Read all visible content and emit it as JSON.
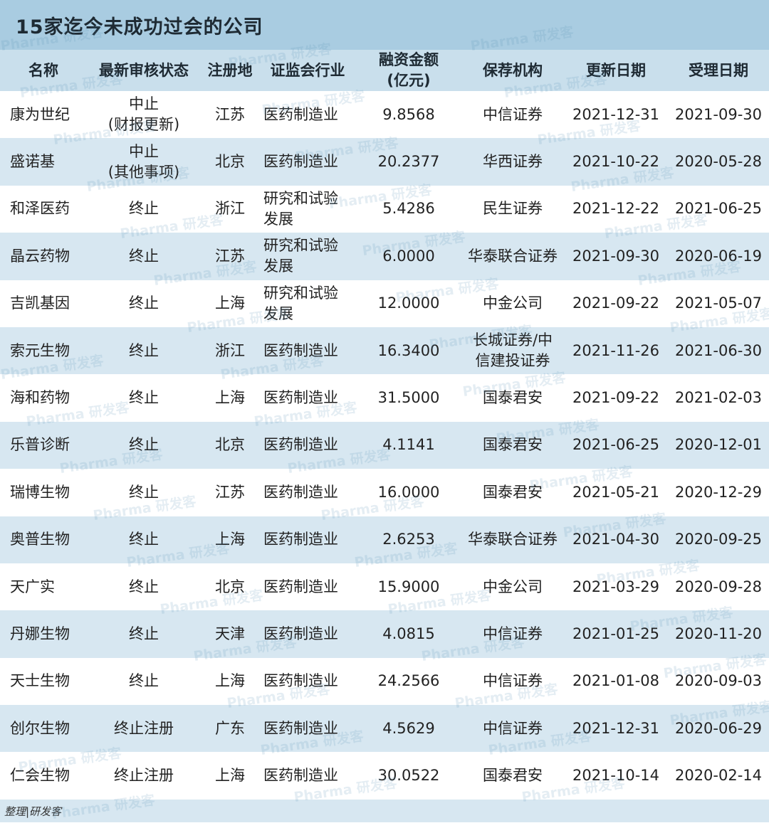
{
  "title": "15家迄今未成功过会的公司",
  "columns": [
    "名称",
    "最新审核状态",
    "注册地",
    "证监会行业",
    "融资金额\n(亿元)",
    "保荐机构",
    "更新日期",
    "受理日期"
  ],
  "rows": [
    [
      "康为世纪",
      "中止\n(财报更新)",
      "江苏",
      "医药制造业",
      "9.8568",
      "中信证券",
      "2021-12-31",
      "2021-09-30"
    ],
    [
      "盛诺基",
      "中止\n(其他事项)",
      "北京",
      "医药制造业",
      "20.2377",
      "华西证券",
      "2021-10-22",
      "2020-05-28"
    ],
    [
      "和泽医药",
      "终止",
      "浙江",
      "研究和试验\n发展",
      "5.4286",
      "民生证券",
      "2021-12-22",
      "2021-06-25"
    ],
    [
      "晶云药物",
      "终止",
      "江苏",
      "研究和试验\n发展",
      "6.0000",
      "华泰联合证券",
      "2021-09-30",
      "2020-06-19"
    ],
    [
      "吉凯基因",
      "终止",
      "上海",
      "研究和试验\n发展",
      "12.0000",
      "中金公司",
      "2021-09-22",
      "2021-05-07"
    ],
    [
      "索元生物",
      "终止",
      "浙江",
      "医药制造业",
      "16.3400",
      "长城证券/中\n信建投证券",
      "2021-11-26",
      "2021-06-30"
    ],
    [
      "海和药物",
      "终止",
      "上海",
      "医药制造业",
      "31.5000",
      "国泰君安",
      "2021-09-22",
      "2021-02-03"
    ],
    [
      "乐普诊断",
      "终止",
      "北京",
      "医药制造业",
      "4.1141",
      "国泰君安",
      "2021-06-25",
      "2020-12-01"
    ],
    [
      "瑞博生物",
      "终止",
      "江苏",
      "医药制造业",
      "16.0000",
      "国泰君安",
      "2021-05-21",
      "2020-12-29"
    ],
    [
      "奥普生物",
      "终止",
      "上海",
      "医药制造业",
      "2.6253",
      "华泰联合证券",
      "2021-04-30",
      "2020-09-25"
    ],
    [
      "天广实",
      "终止",
      "北京",
      "医药制造业",
      "15.9000",
      "中金公司",
      "2021-03-29",
      "2020-09-28"
    ],
    [
      "丹娜生物",
      "终止",
      "天津",
      "医药制造业",
      "4.0815",
      "中信证券",
      "2021-01-25",
      "2020-11-20"
    ],
    [
      "天士生物",
      "终止",
      "上海",
      "医药制造业",
      "24.2566",
      "中信证券",
      "2021-01-08",
      "2020-09-03"
    ],
    [
      "创尔生物",
      "终止注册",
      "广东",
      "医药制造业",
      "4.5629",
      "中信证券",
      "2021-12-31",
      "2020-06-29"
    ],
    [
      "仁会生物",
      "终止注册",
      "上海",
      "医药制造业",
      "30.0522",
      "国泰君安",
      "2021-10-14",
      "2020-02-14"
    ]
  ],
  "source": "整理|研发客",
  "watermark_text": "Pharma 研发客"
}
